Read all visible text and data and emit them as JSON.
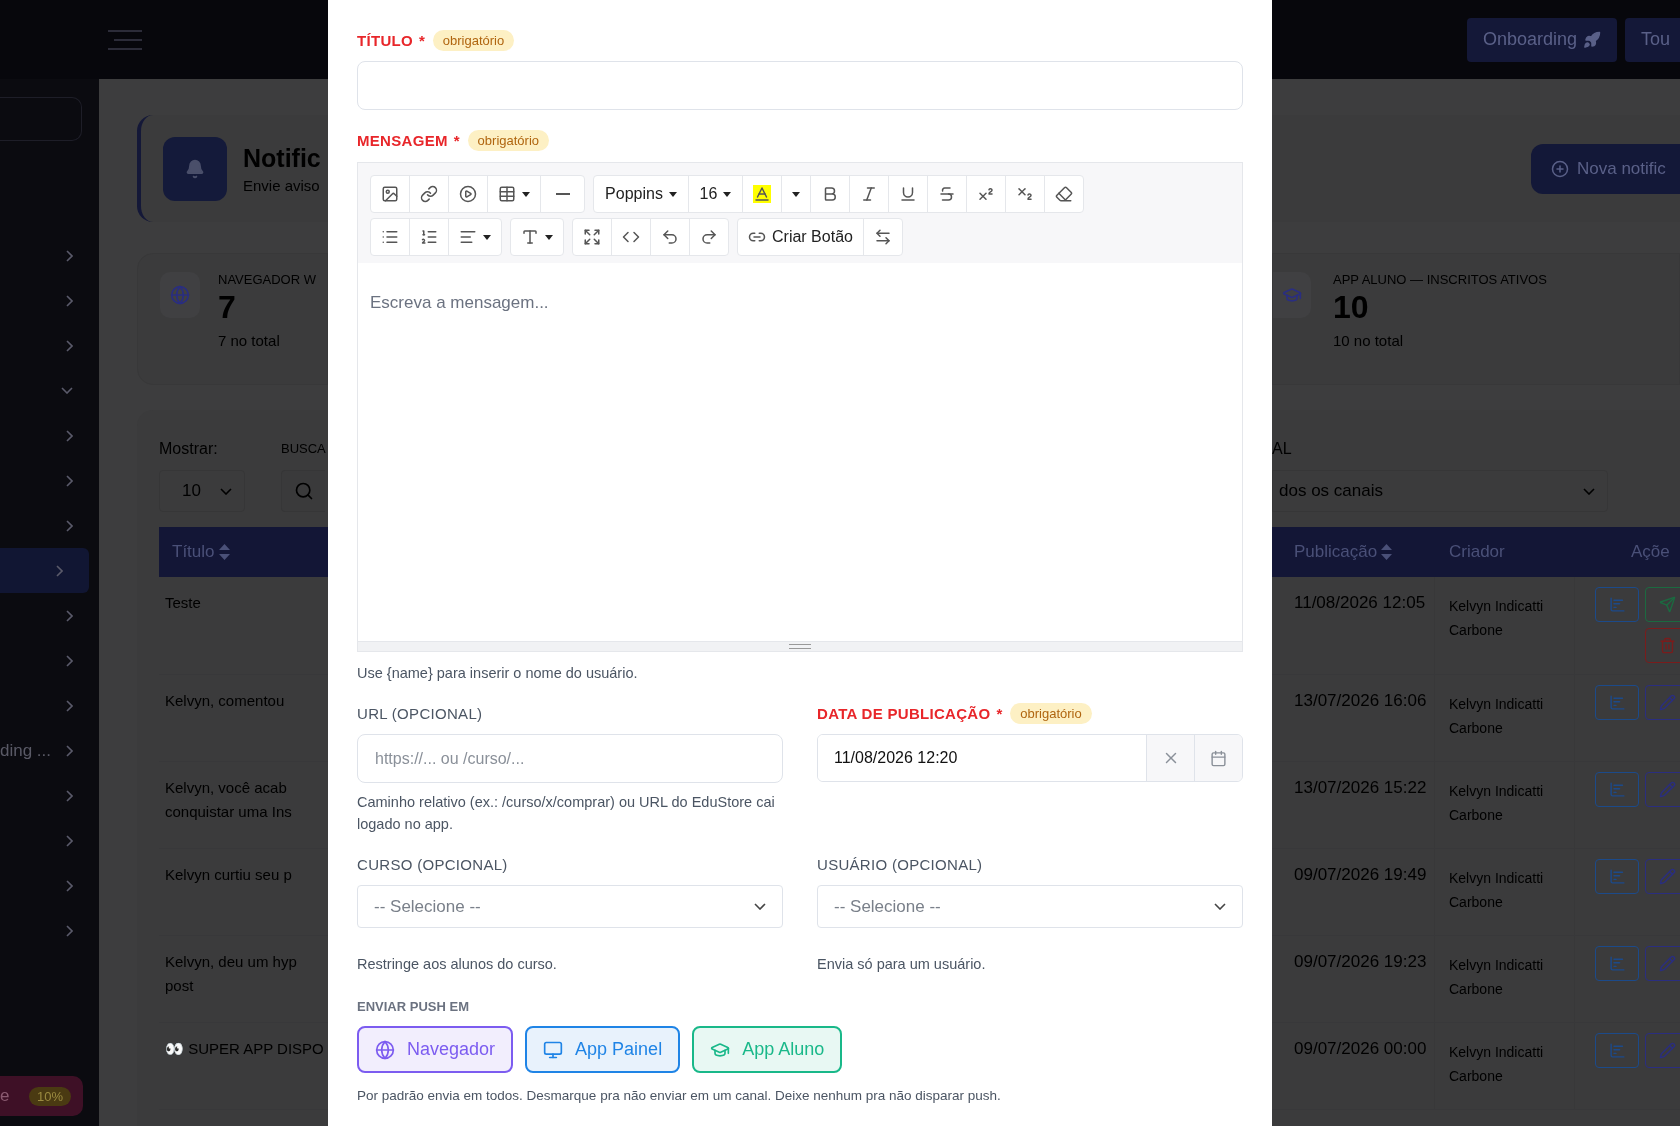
{
  "topbar": {
    "buttons": [
      {
        "label": "Onboarding"
      },
      {
        "label": "Tou"
      }
    ]
  },
  "sidebar": {
    "items": [
      {
        "expanded": false,
        "selected": false
      },
      {
        "expanded": false,
        "selected": false
      },
      {
        "expanded": false,
        "selected": false
      },
      {
        "expanded": true,
        "selected": false
      },
      {
        "expanded": false,
        "selected": false
      },
      {
        "expanded": false,
        "selected": false
      },
      {
        "expanded": false,
        "selected": false
      },
      {
        "expanded": false,
        "selected": true
      },
      {
        "expanded": false,
        "selected": false
      },
      {
        "expanded": false,
        "selected": false
      },
      {
        "expanded": false,
        "selected": false
      },
      {
        "expanded": false,
        "selected": false,
        "label": "ding ..."
      },
      {
        "expanded": false,
        "selected": false
      },
      {
        "expanded": false,
        "selected": false
      },
      {
        "expanded": false,
        "selected": false
      },
      {
        "expanded": false,
        "selected": false
      }
    ],
    "footer": {
      "label": "e",
      "badge": "10%"
    }
  },
  "page_header": {
    "title": "Notific",
    "subtitle": "Envie aviso",
    "action": "Nova notific"
  },
  "stats": [
    {
      "label": "NAVEGADOR W",
      "value": "7",
      "note": "7 no total"
    },
    {
      "label": "APP ALUNO — INSCRITOS ATIVOS",
      "value": "10",
      "note": "10 no total"
    }
  ],
  "filters": {
    "show_label": "Mostrar:",
    "show_value": "10",
    "search_label": "BUSCA",
    "channel_label": "AL",
    "channel_value": "dos os canais"
  },
  "table": {
    "left_columns": [
      {
        "label": "Título",
        "sortable": true
      }
    ],
    "right_columns": [
      {
        "label": "Publicação",
        "sortable": true
      },
      {
        "label": "Criador",
        "sortable": false
      },
      {
        "label": "Açõe"
      }
    ],
    "rows": [
      {
        "title": [
          "Teste"
        ],
        "published": "11/08/2026 12:05",
        "creator": "Kelvyn Indicatti Carbone",
        "actions": [
          {
            "kind": "stats"
          },
          {
            "kind": "send"
          },
          {
            "kind": "delete"
          }
        ]
      },
      {
        "title": [
          "Kelvyn, comentou"
        ],
        "published": "13/07/2026 16:06",
        "creator": "Kelvyn Indicatti Carbone",
        "actions": [
          {
            "kind": "stats"
          },
          {
            "kind": "edit"
          }
        ]
      },
      {
        "title": [
          "Kelvyn, você acab",
          "conquistar uma Ins"
        ],
        "published": "13/07/2026 15:22",
        "creator": "Kelvyn Indicatti Carbone",
        "actions": [
          {
            "kind": "stats"
          },
          {
            "kind": "edit"
          }
        ]
      },
      {
        "title": [
          "Kelvyn curtiu seu p"
        ],
        "published": "09/07/2026 19:49",
        "creator": "Kelvyn Indicatti Carbone",
        "actions": [
          {
            "kind": "stats"
          },
          {
            "kind": "edit"
          }
        ]
      },
      {
        "title": [
          "Kelvyn, deu um hyp",
          "post"
        ],
        "published": "09/07/2026 19:23",
        "creator": "Kelvyn Indicatti Carbone",
        "actions": [
          {
            "kind": "stats"
          },
          {
            "kind": "edit"
          }
        ]
      },
      {
        "title": [
          "👀 SUPER APP DISPO"
        ],
        "published": "09/07/2026 00:00",
        "creator": "Kelvyn Indicatti Carbone",
        "actions": [
          {
            "kind": "stats"
          },
          {
            "kind": "edit"
          }
        ]
      }
    ]
  },
  "modal": {
    "title_field": {
      "label": "TÍTULO",
      "required": true,
      "mark": "*",
      "badge": "obrigatório"
    },
    "message_field": {
      "label": "MENSAGEM",
      "required": true,
      "mark": "*",
      "badge": "obrigatório",
      "placeholder": "Escreva a mensagem...",
      "toolbar": [
        [
          [
            {
              "kind": "image"
            },
            {
              "kind": "link"
            },
            {
              "kind": "video"
            },
            {
              "kind": "table"
            },
            {
              "kind": "rule"
            }
          ],
          [
            {
              "kind": "font"
            },
            {
              "kind": "size"
            },
            {
              "kind": "highlight"
            },
            {
              "kind": "color-caret"
            },
            {
              "kind": "bold"
            },
            {
              "kind": "italic"
            },
            {
              "kind": "underline"
            },
            {
              "kind": "strike"
            },
            {
              "kind": "superscript"
            },
            {
              "kind": "subscript"
            },
            {
              "kind": "eraser"
            }
          ]
        ],
        [
          [
            {
              "kind": "bullet-list"
            },
            {
              "kind": "number-list"
            },
            {
              "kind": "align"
            }
          ],
          [
            {
              "kind": "line-height"
            }
          ],
          [
            {
              "kind": "fullscreen"
            },
            {
              "kind": "code"
            },
            {
              "kind": "undo"
            },
            {
              "kind": "redo"
            }
          ],
          [
            {
              "kind": "create-button"
            },
            {
              "kind": "swap"
            }
          ]
        ]
      ],
      "font": "Poppins",
      "size": "16",
      "create_button": "Criar Botão",
      "hint": "Use {name} para inserir o nome do usuário."
    },
    "url_field": {
      "label": "URL (OPCIONAL)",
      "required": false,
      "placeholder": "https://... ou /curso/...",
      "hint": "Caminho relativo (ex.: /curso/x/comprar) ou URL do EduStore cai logado no app."
    },
    "date_field": {
      "label": "DATA DE PUBLICAÇÃO",
      "required": true,
      "mark": "*",
      "badge": "obrigatório",
      "value": "11/08/2026 12:20"
    },
    "course_field": {
      "label": "CURSO (OPCIONAL)",
      "required": false,
      "placeholder": "-- Selecione --",
      "hint": "Restringe aos alunos do curso."
    },
    "user_field": {
      "label": "USUÁRIO (OPCIONAL)",
      "required": false,
      "placeholder": "-- Selecione --",
      "hint": "Envia só para um usuário."
    },
    "push": {
      "label": "ENVIAR PUSH EM",
      "channels": [
        {
          "kind": "globe",
          "label": "Navegador",
          "selected": true,
          "color": "#7c5cf0"
        },
        {
          "kind": "monitor",
          "label": "App Painel",
          "selected": true,
          "color": "#1f84e6"
        },
        {
          "kind": "graduation",
          "label": "App Aluno",
          "selected": true,
          "color": "#19b889"
        }
      ],
      "hint": "Por padrão envia em todos. Desmarque pra não enviar em um canal. Deixe nenhum pra não disparar push."
    }
  }
}
